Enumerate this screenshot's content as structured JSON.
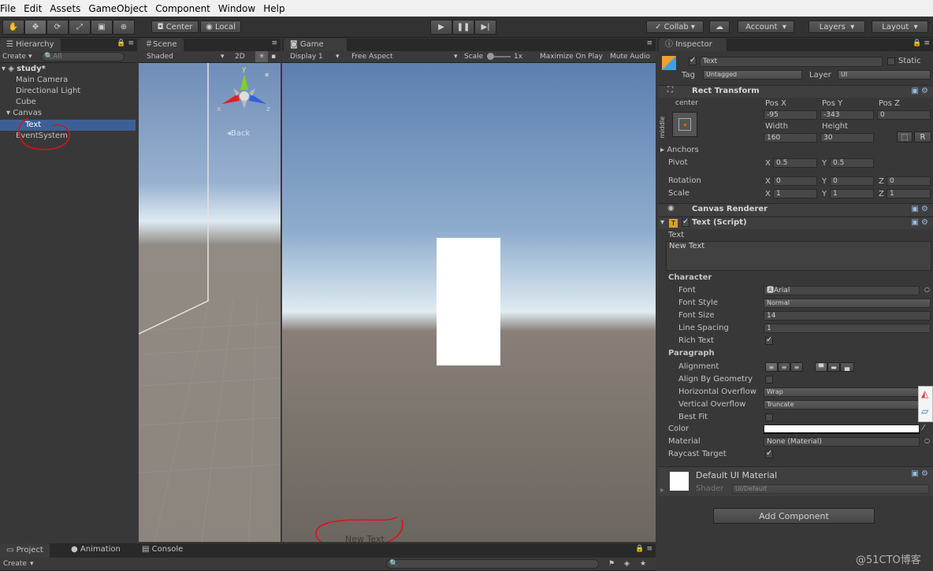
{
  "menu": [
    "File",
    "Edit",
    "Assets",
    "GameObject",
    "Component",
    "Window",
    "Help"
  ],
  "toolbar": {
    "center": "Center",
    "local": "Local",
    "collab": "Collab",
    "account": "Account",
    "layers": "Layers",
    "layout": "Layout"
  },
  "hierarchy": {
    "tab": "Hierarchy",
    "create": "Create",
    "search": "All",
    "scene": "study*",
    "items": [
      "Main Camera",
      "Directional Light",
      "Cube",
      "Canvas",
      "Text",
      "EventSystem"
    ]
  },
  "scene": {
    "tab": "Scene",
    "shading": "Shaded",
    "mode2d": "2D",
    "back": "Back",
    "gizmo_x": "x",
    "gizmo_y": "y",
    "gizmo_z": "z"
  },
  "game": {
    "tab": "Game",
    "display": "Display 1",
    "aspect": "Free Aspect",
    "scale_label": "Scale",
    "scale_value": "1x",
    "maximize": "Maximize On Play",
    "mute": "Mute Audio",
    "overlay_text": "New Text"
  },
  "inspector": {
    "tab": "Inspector",
    "object_name": "Text",
    "static": "Static",
    "tag_label": "Tag",
    "tag": "Untagged",
    "layer_label": "Layer",
    "layer": "UI",
    "rect": {
      "title": "Rect Transform",
      "anchor_h": "center",
      "anchor_v": "middle",
      "posx_label": "Pos X",
      "posy_label": "Pos Y",
      "posz_label": "Pos Z",
      "posx": "-95",
      "posy": "-343",
      "posz": "0",
      "width_label": "Width",
      "height_label": "Height",
      "width": "160",
      "height": "30",
      "r": "R",
      "anchors": "Anchors",
      "pivot": "Pivot",
      "pivot_x": "0.5",
      "pivot_y": "0.5",
      "rotation": "Rotation",
      "scale": "Scale",
      "rot_x": "0",
      "rot_y": "0",
      "rot_z": "0",
      "sc_x": "1",
      "sc_y": "1",
      "sc_z": "1",
      "x": "X",
      "y": "Y",
      "z": "Z"
    },
    "canvas_renderer": "Canvas Renderer",
    "text_script": {
      "title": "Text (Script)",
      "text_label": "Text",
      "text_value": "New Text",
      "character": "Character",
      "font_label": "Font",
      "font": "Arial",
      "font_style_label": "Font Style",
      "font_style": "Normal",
      "font_size_label": "Font Size",
      "font_size": "14",
      "line_spacing_label": "Line Spacing",
      "line_spacing": "1",
      "rich_text": "Rich Text",
      "paragraph": "Paragraph",
      "alignment": "Alignment",
      "align_geometry": "Align By Geometry",
      "h_overflow_label": "Horizontal Overflow",
      "h_overflow": "Wrap",
      "v_overflow_label": "Vertical Overflow",
      "v_overflow": "Truncate",
      "best_fit": "Best Fit",
      "color": "Color",
      "material_label": "Material",
      "material": "None (Material)",
      "raycast": "Raycast Target"
    },
    "material": {
      "title": "Default UI Material",
      "shader_label": "Shader",
      "shader": "UI/Default"
    },
    "add_component": "Add Component"
  },
  "bottom": {
    "project": "Project",
    "animation": "Animation",
    "console": "Console",
    "create": "Create"
  },
  "watermark": "@51CTO博客",
  "colors": {
    "selection": "#3e5f96",
    "annotation": "#e0101a"
  }
}
